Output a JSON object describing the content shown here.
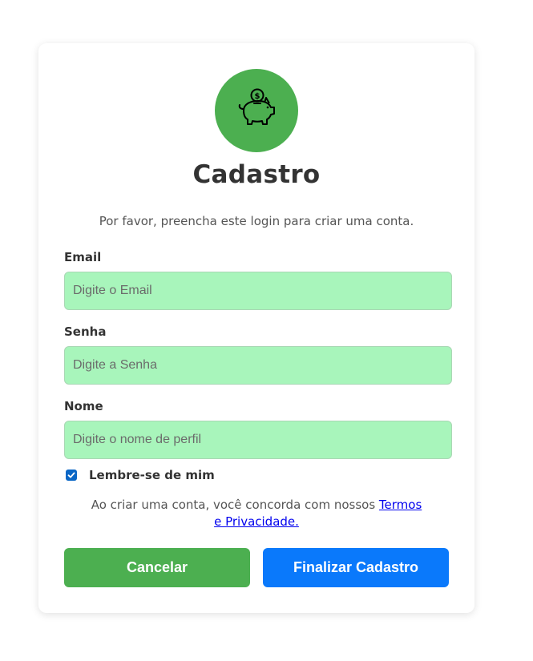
{
  "brand": {
    "logo_icon": "piggy-bank-icon",
    "logo_color": "#4caf50"
  },
  "form": {
    "title": "Cadastro",
    "subtitle": "Por favor, preencha este login para criar uma conta.",
    "email": {
      "label": "Email",
      "placeholder": "Digite o Email",
      "value": ""
    },
    "password": {
      "label": "Senha",
      "placeholder": "Digite a Senha",
      "value": ""
    },
    "name": {
      "label": "Nome",
      "placeholder": "Digite o nome de perfil",
      "value": ""
    },
    "remember": {
      "label": "Lembre-se de mim",
      "checked": true
    },
    "terms": {
      "text": "Ao criar uma conta, você concorda com nossos ",
      "link": "Termos e Privacidade."
    },
    "buttons": {
      "cancel": "Cancelar",
      "submit": "Finalizar Cadastro"
    }
  },
  "colors": {
    "input_bg": "#a8f5bb",
    "cancel_bg": "#4caf50",
    "submit_bg": "#0a79fb",
    "link": "#0000ee"
  }
}
